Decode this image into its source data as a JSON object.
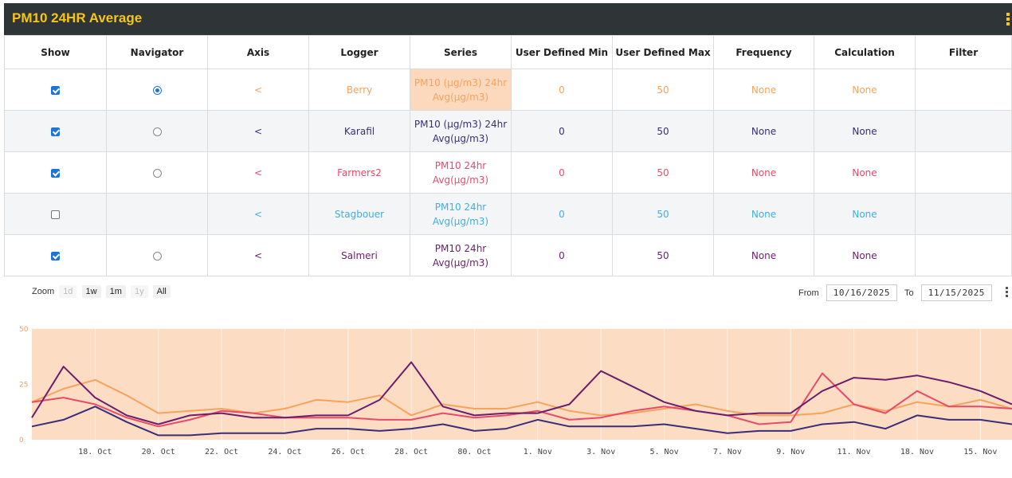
{
  "header": {
    "title": "PM10 24HR Average",
    "menu_icon": "vertical-ellipsis-icon"
  },
  "table": {
    "columns": [
      "Show",
      "Navigator",
      "Axis",
      "Logger",
      "Series",
      "User Defined Min",
      "User Defined Max",
      "Frequency",
      "Calculation",
      "Filter"
    ],
    "rows": [
      {
        "show": true,
        "navigator": "selected",
        "axis": "<",
        "logger": "Berry",
        "series1": "PM10 (µg/m3) 24hr",
        "series2": "Avg(µg/m3)",
        "min": "0",
        "max": "50",
        "frequency": "None",
        "calculation": "None",
        "filter": "",
        "color": "#f7a35c",
        "highlight": true
      },
      {
        "show": true,
        "navigator": "unselected",
        "axis": "<",
        "logger": "Karafil",
        "series1": "PM10 (µg/m3) 24hr",
        "series2": "Avg(µg/m3)",
        "min": "0",
        "max": "50",
        "frequency": "None",
        "calculation": "None",
        "filter": "",
        "color": "#3a2d7a",
        "highlight": false
      },
      {
        "show": true,
        "navigator": "unselected",
        "axis": "<",
        "logger": "Farmers2",
        "series1": "PM10 24hr",
        "series2": "Avg(µg/m3)",
        "min": "0",
        "max": "50",
        "frequency": "None",
        "calculation": "None",
        "filter": "",
        "color": "#e94a6a",
        "highlight": false
      },
      {
        "show": false,
        "navigator": "none",
        "axis": "<",
        "logger": "Stagbouer",
        "series1": "PM10 24hr",
        "series2": "Avg(µg/m3)",
        "min": "0",
        "max": "50",
        "frequency": "None",
        "calculation": "None",
        "filter": "",
        "color": "#3fb0e3",
        "highlight": false
      },
      {
        "show": true,
        "navigator": "unselected",
        "axis": "<",
        "logger": "Salmeri",
        "series1": "PM10 24hr",
        "series2": "Avg(µg/m3)",
        "min": "0",
        "max": "50",
        "frequency": "None",
        "calculation": "None",
        "filter": "",
        "color": "#6b1f6b",
        "highlight": false
      }
    ]
  },
  "zoom": {
    "label": "Zoom",
    "buttons": [
      {
        "label": "1d",
        "enabled": false
      },
      {
        "label": "1w",
        "enabled": true
      },
      {
        "label": "1m",
        "enabled": true
      },
      {
        "label": "1y",
        "enabled": false
      },
      {
        "label": "All",
        "enabled": true
      }
    ]
  },
  "range": {
    "from_label": "From",
    "from": "10/16/2025",
    "to_label": "To",
    "to": "11/15/2025"
  },
  "chart_data": {
    "type": "line",
    "ylim": [
      0,
      60
    ],
    "yticks": [
      0,
      25,
      50
    ],
    "band": {
      "from": 0,
      "to": 50,
      "color": "#fddcc4"
    },
    "grid": "vertical",
    "x": [
      "10/16",
      "10/17",
      "10/18",
      "10/19",
      "10/20",
      "10/21",
      "10/22",
      "10/23",
      "10/24",
      "10/25",
      "10/26",
      "10/27",
      "10/28",
      "10/29",
      "10/30",
      "10/31",
      "11/01",
      "11/02",
      "11/03",
      "11/04",
      "11/05",
      "11/06",
      "11/07",
      "11/08",
      "11/09",
      "11/10",
      "11/11",
      "11/12",
      "11/13",
      "11/14",
      "11/15",
      "11/16"
    ],
    "xticks": [
      {
        "label": "18. Oct",
        "x": "10/18"
      },
      {
        "label": "20. Oct",
        "x": "10/20"
      },
      {
        "label": "22. Oct",
        "x": "10/22"
      },
      {
        "label": "24. Oct",
        "x": "10/24"
      },
      {
        "label": "26. Oct",
        "x": "10/26"
      },
      {
        "label": "28. Oct",
        "x": "10/28"
      },
      {
        "label": "80. Oct",
        "x": "10/30"
      },
      {
        "label": "1. Nov",
        "x": "11/01"
      },
      {
        "label": "3. Nov",
        "x": "11/03"
      },
      {
        "label": "5. Nov",
        "x": "11/05"
      },
      {
        "label": "7. Nov",
        "x": "11/07"
      },
      {
        "label": "9. Nov",
        "x": "11/09"
      },
      {
        "label": "11. Nov",
        "x": "11/11"
      },
      {
        "label": "18. Nov",
        "x": "11/13"
      },
      {
        "label": "15. Nov",
        "x": "11/15"
      }
    ],
    "series": [
      {
        "color": "#f7a35c",
        "values": [
          17,
          23,
          27,
          20,
          12,
          13,
          14,
          12,
          14,
          18,
          17,
          20,
          11,
          16,
          14,
          14,
          17,
          13,
          11,
          12,
          14,
          16,
          13,
          11,
          11,
          12,
          16,
          13,
          17,
          15,
          18,
          14
        ]
      },
      {
        "color": "#3a2d7a",
        "values": [
          6,
          9,
          15,
          8,
          2,
          2,
          3,
          3,
          3,
          5,
          5,
          4,
          5,
          7,
          4,
          5,
          9,
          6,
          6,
          6,
          7,
          5,
          3,
          4,
          4,
          7,
          8,
          5,
          11,
          9,
          9,
          7
        ]
      },
      {
        "color": "#e94a6a",
        "values": [
          17,
          19,
          16,
          10,
          6,
          9,
          13,
          12,
          10,
          10,
          10,
          9,
          9,
          12,
          10,
          11,
          13,
          9,
          10,
          13,
          15,
          13,
          11,
          7,
          8,
          30,
          16,
          12,
          22,
          15,
          15,
          14
        ]
      },
      {
        "color": "#6b1f6b",
        "values": [
          10,
          33,
          19,
          11,
          7,
          11,
          12,
          10,
          10,
          11,
          11,
          18,
          35,
          15,
          11,
          12,
          12,
          16,
          31,
          24,
          17,
          13,
          11,
          12,
          12,
          22,
          28,
          27,
          29,
          26,
          22,
          16
        ]
      }
    ]
  }
}
